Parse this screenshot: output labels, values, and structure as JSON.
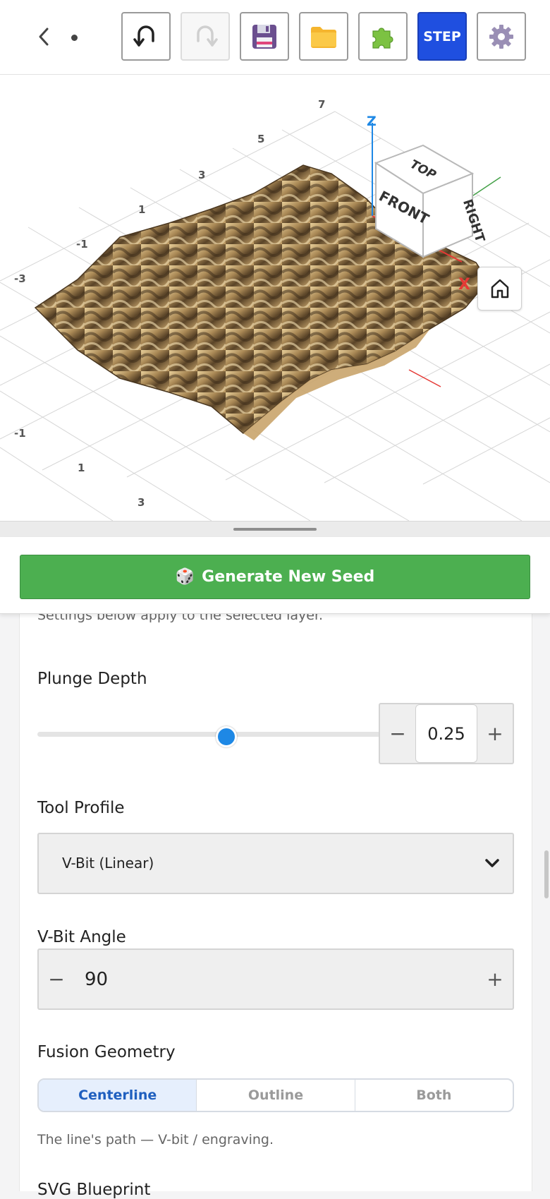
{
  "toolbar": {
    "step_label": "STEP"
  },
  "viewport": {
    "axis_labels": {
      "z": "Z",
      "x": "X"
    },
    "grid_ticks": [
      "7",
      "5",
      "3",
      "1",
      "-1",
      "-3",
      "-1",
      "1",
      "3"
    ],
    "view_cube": {
      "top": "TOP",
      "front": "FRONT",
      "right": "RIGHT"
    }
  },
  "generate": {
    "icon": "🎲",
    "label": "Generate New Seed"
  },
  "panel": {
    "hint": "Settings below apply to the selected layer.",
    "plunge_depth": {
      "label": "Plunge Depth",
      "value": "0.25",
      "fraction": 0.55
    },
    "tool_profile": {
      "label": "Tool Profile",
      "selected": "V-Bit (Linear)"
    },
    "vbit_angle": {
      "label": "V-Bit Angle",
      "value": "90"
    },
    "fusion_geometry": {
      "label": "Fusion Geometry",
      "options": [
        "Centerline",
        "Outline",
        "Both"
      ],
      "selected": "Centerline",
      "description": "The line's path — V-bit / engraving."
    },
    "next_section": "SVG Blueprint"
  },
  "colors": {
    "accent": "#1f4fe0",
    "generate": "#4caf50",
    "slider": "#1e88e5"
  }
}
